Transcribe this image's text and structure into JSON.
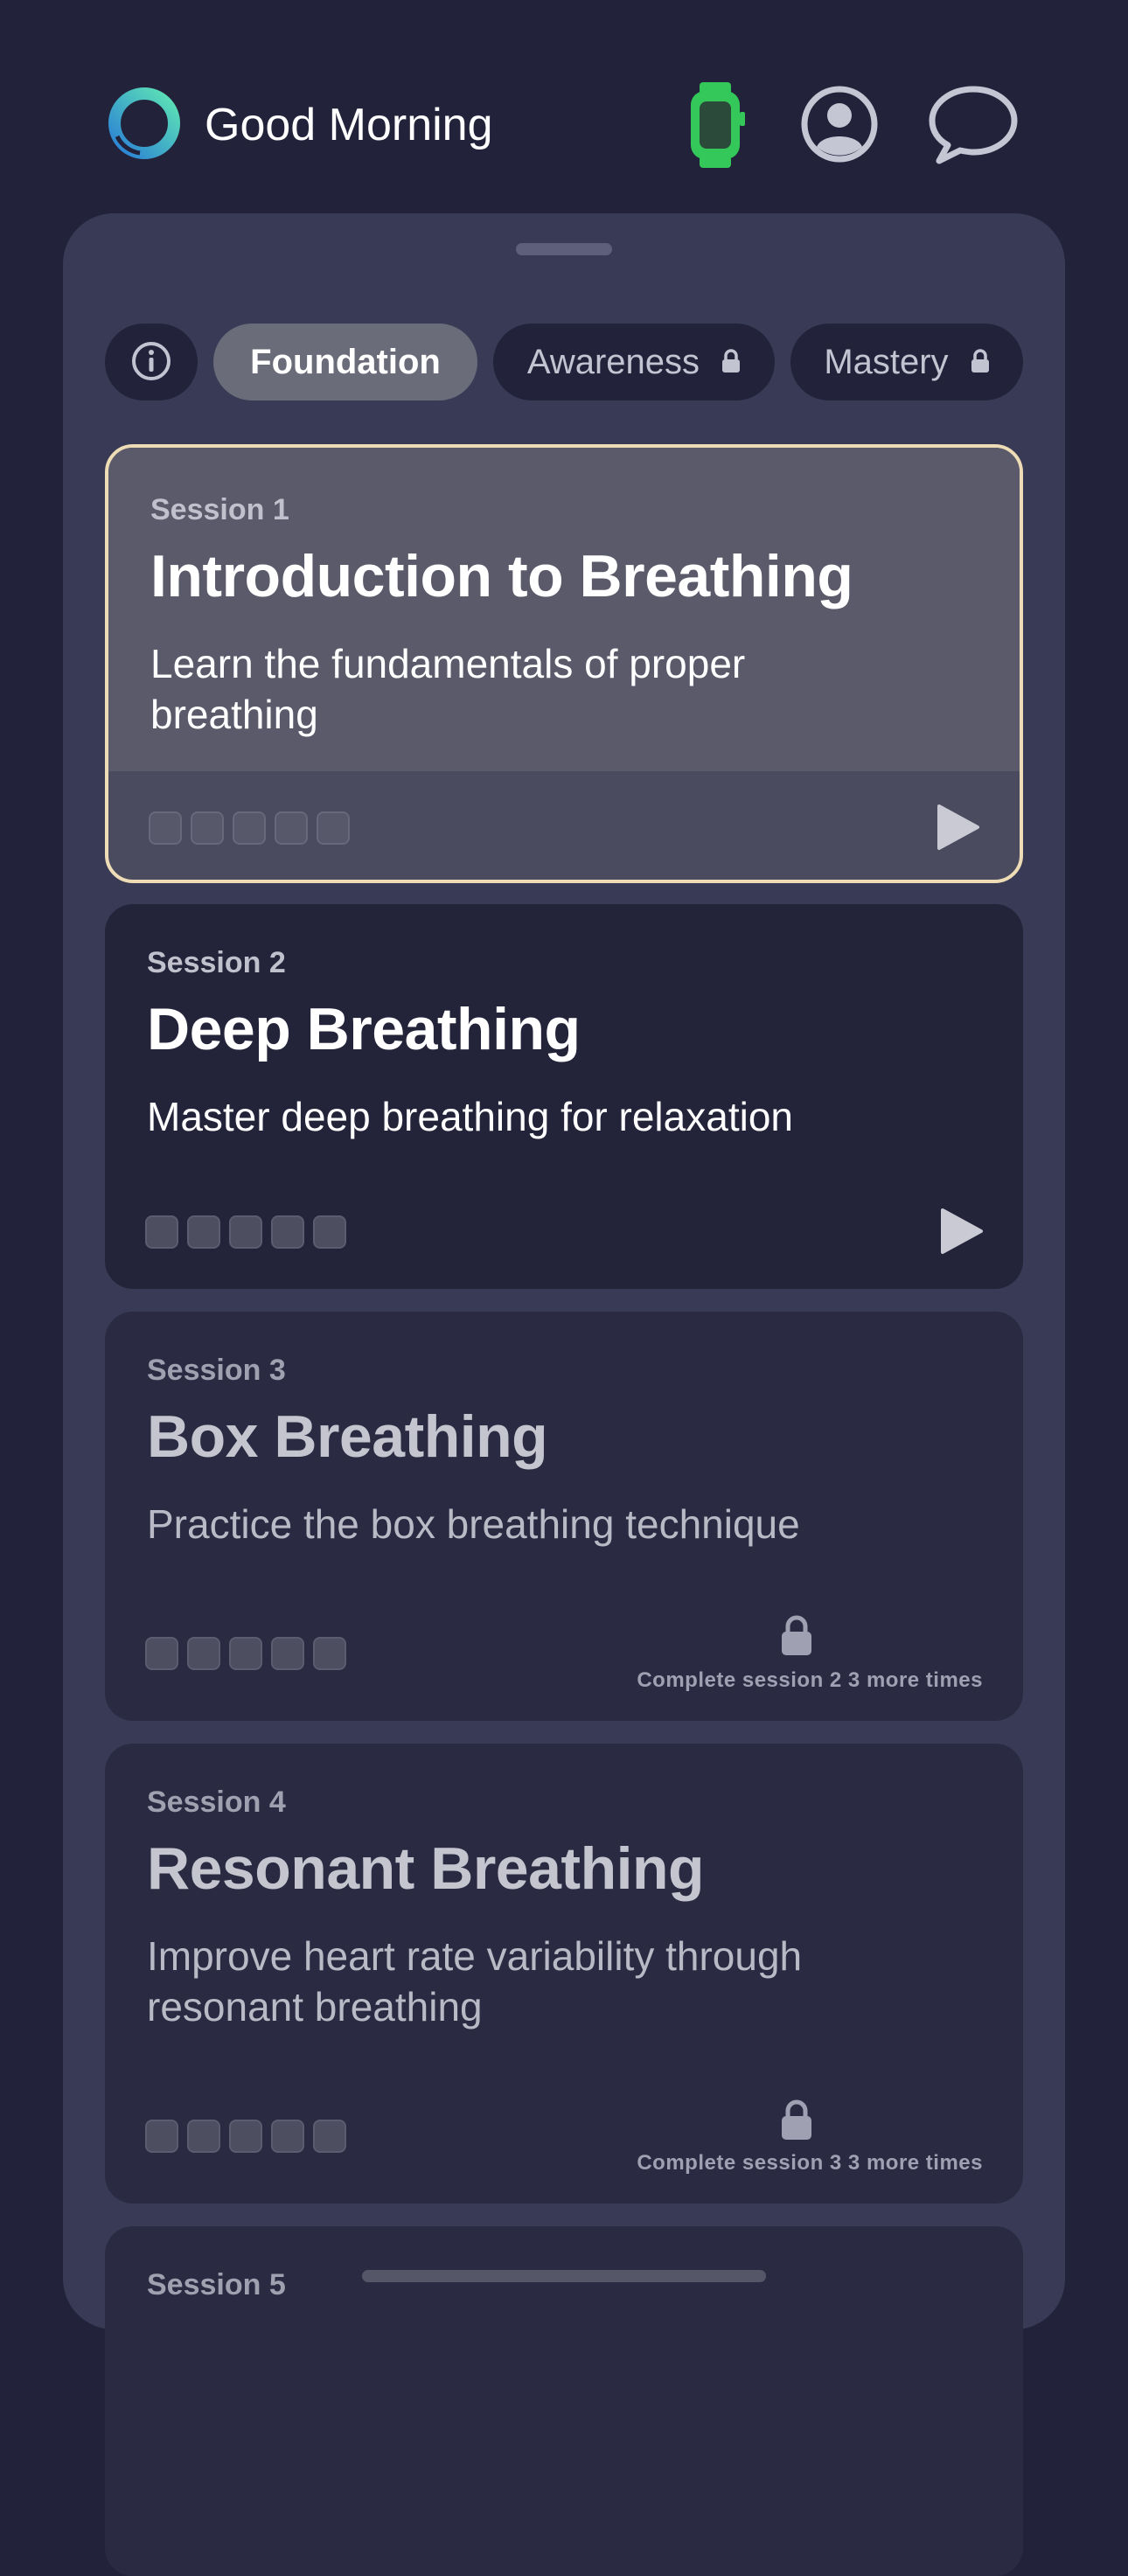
{
  "header": {
    "greeting": "Good Morning",
    "icons": [
      "app-logo",
      "watch-icon",
      "profile-icon",
      "chat-icon"
    ]
  },
  "tabs": [
    {
      "label": "Foundation",
      "selected": true,
      "locked": false
    },
    {
      "label": "Awareness",
      "selected": false,
      "locked": true
    },
    {
      "label": "Mastery",
      "selected": false,
      "locked": true
    }
  ],
  "sessions": [
    {
      "label": "Session 1",
      "title": "Introduction to Breathing",
      "description": "Learn the fundamentals of proper breathing",
      "completed": 0,
      "total": 5,
      "locked": false
    },
    {
      "label": "Session 2",
      "title": "Deep Breathing",
      "description": "Master deep breathing for relaxation",
      "completed": 0,
      "total": 5,
      "locked": false
    },
    {
      "label": "Session 3",
      "title": "Box Breathing",
      "description": "Practice the box breathing technique",
      "completed": 0,
      "total": 5,
      "locked": true,
      "lock_note": "Complete session 2 3 more times"
    },
    {
      "label": "Session 4",
      "title": "Resonant Breathing",
      "description": "Improve heart rate variability through resonant breathing",
      "completed": 0,
      "total": 5,
      "locked": true,
      "lock_note": "Complete session 3 3 more times"
    },
    {
      "label": "Session 5"
    }
  ],
  "colors": {
    "background": "#22233a",
    "sheet": "#393a56",
    "selected_border": "#eddcb5",
    "watch_green": "#34c759",
    "logo_gradient": [
      "#2a7fd6",
      "#5ee6b4"
    ]
  }
}
